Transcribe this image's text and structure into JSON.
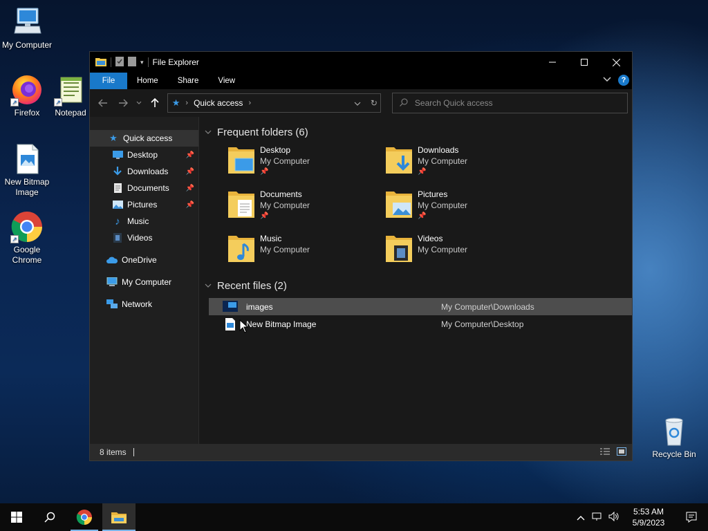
{
  "desktop": {
    "icons": [
      {
        "label": "My Computer",
        "icon": "computer-icon"
      },
      {
        "label": "Firefox",
        "icon": "firefox-icon"
      },
      {
        "label": "Notepad",
        "icon": "notepad-icon"
      },
      {
        "label": "New Bitmap Image",
        "icon": "bitmap-file-icon"
      },
      {
        "label": "Google Chrome",
        "icon": "chrome-icon"
      },
      {
        "label": "Recycle Bin",
        "icon": "recycle-bin-icon"
      }
    ]
  },
  "window": {
    "title": "File Explorer",
    "ribbon_tabs": [
      "File",
      "Home",
      "Share",
      "View"
    ],
    "address": {
      "crumb": "Quick access"
    },
    "search": {
      "placeholder": "Search Quick access"
    },
    "nav_pane": [
      {
        "label": "Quick access",
        "icon": "star-icon",
        "selected": true
      },
      {
        "label": "Desktop",
        "icon": "desktop-icon",
        "pinned": true
      },
      {
        "label": "Downloads",
        "icon": "download-icon",
        "pinned": true
      },
      {
        "label": "Documents",
        "icon": "documents-icon",
        "pinned": true
      },
      {
        "label": "Pictures",
        "icon": "pictures-icon",
        "pinned": true
      },
      {
        "label": "Music",
        "icon": "music-icon"
      },
      {
        "label": "Videos",
        "icon": "videos-icon"
      },
      {
        "label": "OneDrive",
        "icon": "cloud-icon"
      },
      {
        "label": "My Computer",
        "icon": "computer-icon"
      },
      {
        "label": "Network",
        "icon": "network-icon"
      }
    ],
    "frequent": {
      "header": "Frequent folders (6)",
      "folders": [
        {
          "name": "Desktop",
          "location": "My Computer",
          "pinned": true
        },
        {
          "name": "Downloads",
          "location": "My Computer",
          "pinned": true
        },
        {
          "name": "Documents",
          "location": "My Computer",
          "pinned": true
        },
        {
          "name": "Pictures",
          "location": "My Computer",
          "pinned": true
        },
        {
          "name": "Music",
          "location": "My Computer",
          "pinned": false
        },
        {
          "name": "Videos",
          "location": "My Computer",
          "pinned": false
        }
      ]
    },
    "recent": {
      "header": "Recent files (2)",
      "files": [
        {
          "name": "images",
          "path": "My Computer\\Downloads"
        },
        {
          "name": "New Bitmap Image",
          "path": "My Computer\\Desktop"
        }
      ]
    },
    "status": {
      "items": "8 items"
    }
  },
  "taskbar": {
    "time": "5:53 AM",
    "date": "5/9/2023"
  },
  "colors": {
    "accent": "#1979ca",
    "window_bg": "#191919",
    "nav_bg": "#1f1f1f",
    "folder_yellow": "#f2c94c"
  }
}
